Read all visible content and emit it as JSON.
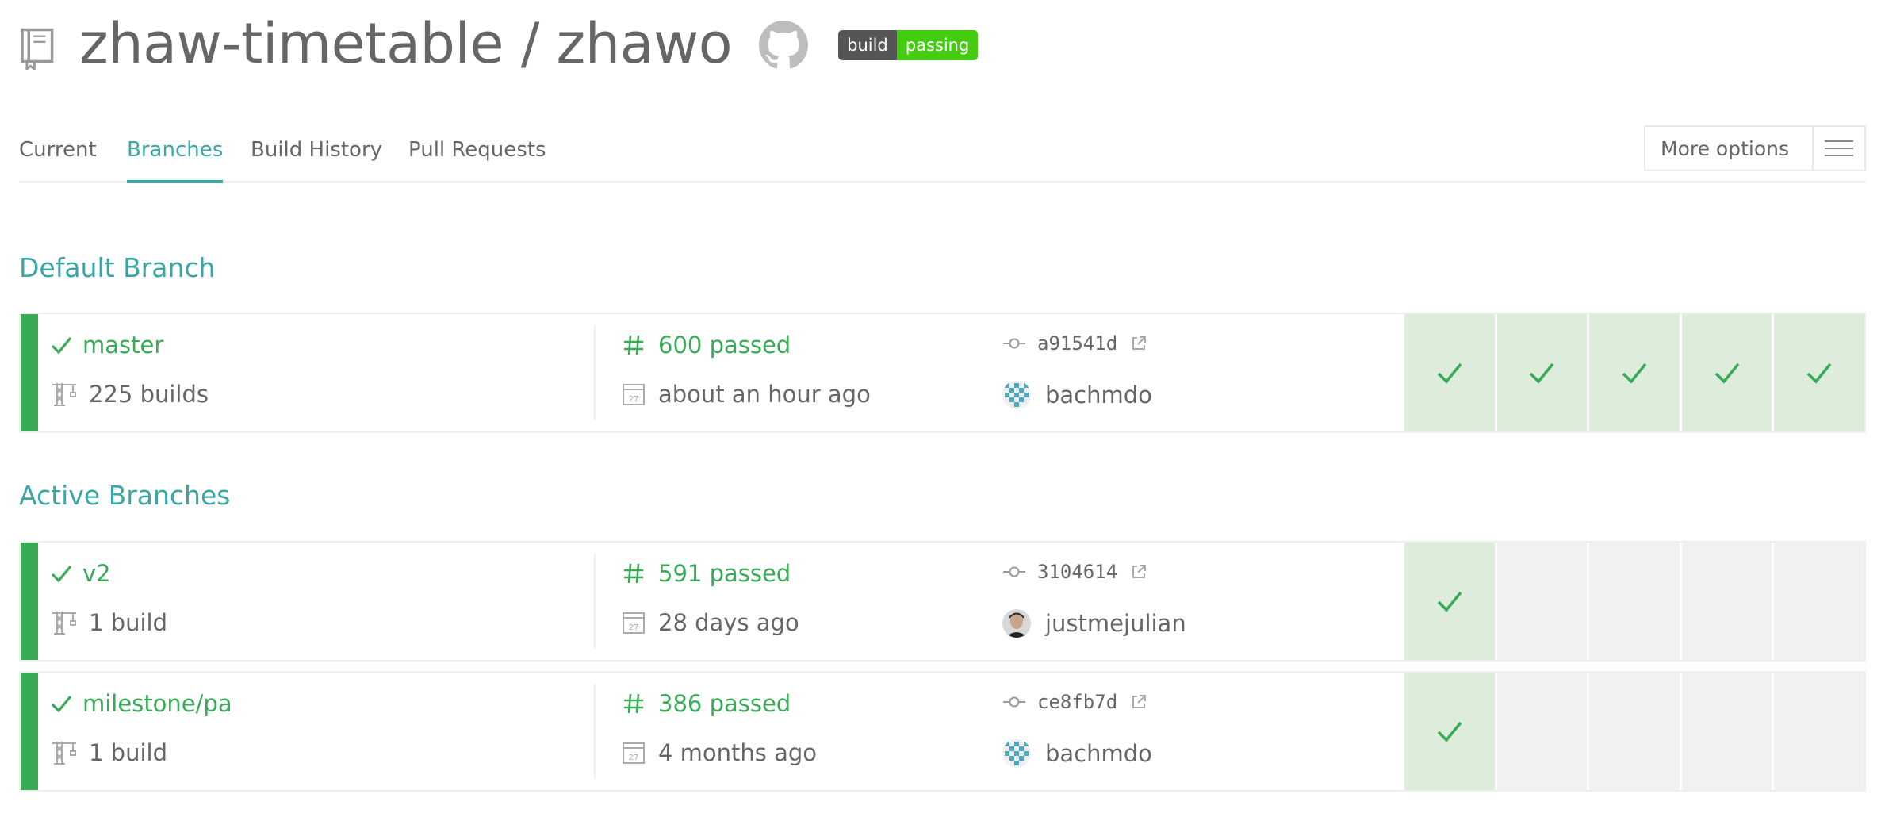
{
  "header": {
    "repo_title": "zhaw-timetable / zhawo",
    "badge": {
      "left": "build",
      "right": "passing"
    },
    "icons": {
      "repo": "repo-book-icon",
      "github": "github-octocat-icon"
    }
  },
  "tabs": [
    {
      "label": "Current",
      "active": false
    },
    {
      "label": "Branches",
      "active": true
    },
    {
      "label": "Build History",
      "active": false
    },
    {
      "label": "Pull Requests",
      "active": false
    }
  ],
  "more_options": {
    "label": "More options",
    "icon": "hamburger-menu-icon"
  },
  "sections": {
    "default_title": "Default Branch",
    "active_title": "Active Branches"
  },
  "branches": [
    {
      "name": "master",
      "builds": "225 builds",
      "build_state": "600 passed",
      "time": "about an hour ago",
      "sha": "a91541d",
      "author": "bachmdo",
      "history": [
        "passed",
        "passed",
        "passed",
        "passed",
        "passed"
      ]
    },
    {
      "name": "v2",
      "builds": "1 build",
      "build_state": "591 passed",
      "time": "28 days ago",
      "sha": "3104614",
      "author": "justmejulian",
      "history": [
        "passed",
        "empty",
        "empty",
        "empty",
        "empty"
      ]
    },
    {
      "name": "milestone/pa",
      "builds": "1 build",
      "build_state": "386 passed",
      "time": "4 months ago",
      "sha": "ce8fb7d",
      "author": "bachmdo",
      "history": [
        "passed",
        "empty",
        "empty",
        "empty",
        "empty"
      ]
    }
  ],
  "colors": {
    "passed": "#39aa56",
    "accent": "#3aa6a6",
    "passed_cell": "#deecdc",
    "empty_cell": "#f1f1f1",
    "badge_green": "#44cc11",
    "badge_gray": "#555555"
  }
}
